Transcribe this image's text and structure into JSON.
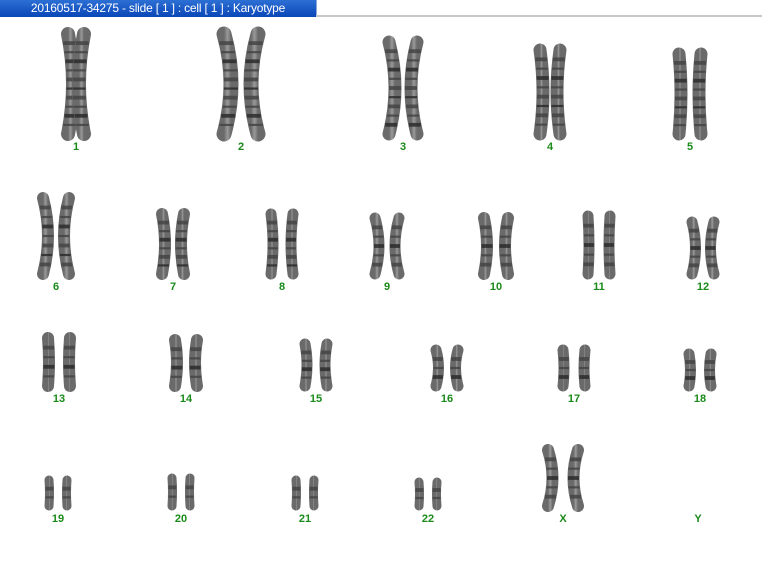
{
  "window": {
    "title": "20160517-34275 - slide [ 1 ] : cell [ 1 ] : Karyotype"
  },
  "colors": {
    "title_bar": "#0a46b8",
    "label": "#1a8a1a",
    "chromatid": "#8c8c8c"
  },
  "karyotype": {
    "chromosomes": [
      {
        "label": "1"
      },
      {
        "label": "2"
      },
      {
        "label": "3"
      },
      {
        "label": "4"
      },
      {
        "label": "5"
      },
      {
        "label": "6"
      },
      {
        "label": "7"
      },
      {
        "label": "8"
      },
      {
        "label": "9"
      },
      {
        "label": "10"
      },
      {
        "label": "11"
      },
      {
        "label": "12"
      },
      {
        "label": "13"
      },
      {
        "label": "14"
      },
      {
        "label": "15"
      },
      {
        "label": "16"
      },
      {
        "label": "17"
      },
      {
        "label": "18"
      },
      {
        "label": "19"
      },
      {
        "label": "20"
      },
      {
        "label": "21"
      },
      {
        "label": "22"
      },
      {
        "label": "X"
      },
      {
        "label": "Y"
      }
    ]
  }
}
